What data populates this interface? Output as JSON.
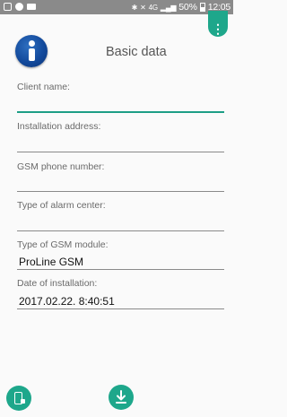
{
  "status_bar": {
    "icons_left": [
      "image-icon",
      "whatsapp-icon",
      "camera-icon"
    ],
    "icons_right": [
      "bluetooth-icon",
      "mute-icon",
      "signal-icon"
    ],
    "network": "4G",
    "battery": "50%",
    "time": "12:05"
  },
  "header": {
    "title": "Basic data",
    "icon": "info-icon"
  },
  "form": {
    "client_name": {
      "label": "Client name:",
      "value": ""
    },
    "installation_address": {
      "label": "Installation address:",
      "value": ""
    },
    "gsm_phone": {
      "label": "GSM phone number:",
      "value": ""
    },
    "alarm_center": {
      "label": "Type of alarm center:",
      "value": ""
    },
    "gsm_module": {
      "label": "Type of GSM module:",
      "value": "ProLine GSM"
    },
    "install_date": {
      "label": "Date of installation:",
      "value": "2017.02.22. 8:40:51"
    }
  },
  "bottom": {
    "left_icon": "phone-lock-icon",
    "center_icon": "download-icon"
  },
  "colors": {
    "accent": "#1ea78b",
    "status_bar": "#8a8a8a"
  }
}
